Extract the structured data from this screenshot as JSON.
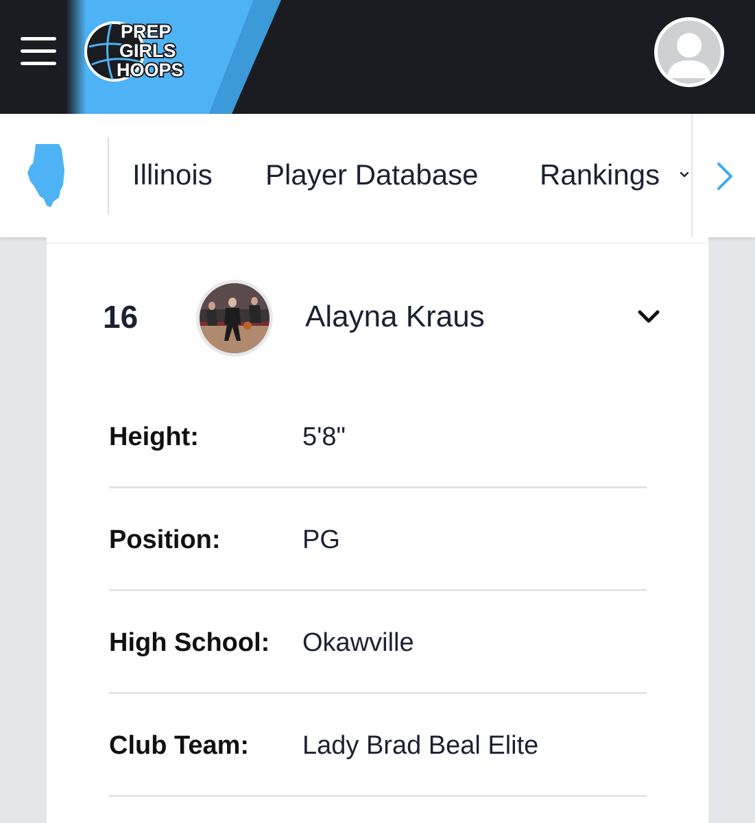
{
  "header": {
    "logo_text": [
      "PREP",
      "GIRLS",
      "HOOPS"
    ],
    "menu_icon": "hamburger-icon",
    "profile_icon": "user-avatar-icon",
    "colors": {
      "bar": "#1a1c22",
      "accent": "#4eb3f4"
    }
  },
  "nav": {
    "state_icon": "illinois-state-icon",
    "items": [
      {
        "label": "Illinois"
      },
      {
        "label": "Player Database"
      },
      {
        "label": "Rankings"
      }
    ],
    "rankings_caret_icon": "chevron-down-icon",
    "scroll_right_icon": "chevron-right-icon"
  },
  "player": {
    "rank": "16",
    "name": "Alayna Kraus",
    "photo_icon": "player-photo",
    "expand_icon": "chevron-down-icon",
    "details": [
      {
        "label": "Height:",
        "value": "5'8\""
      },
      {
        "label": "Position:",
        "value": "PG"
      },
      {
        "label": "High School:",
        "value": "Okawville"
      },
      {
        "label": "Club Team:",
        "value": "Lady Brad Beal Elite"
      }
    ]
  }
}
